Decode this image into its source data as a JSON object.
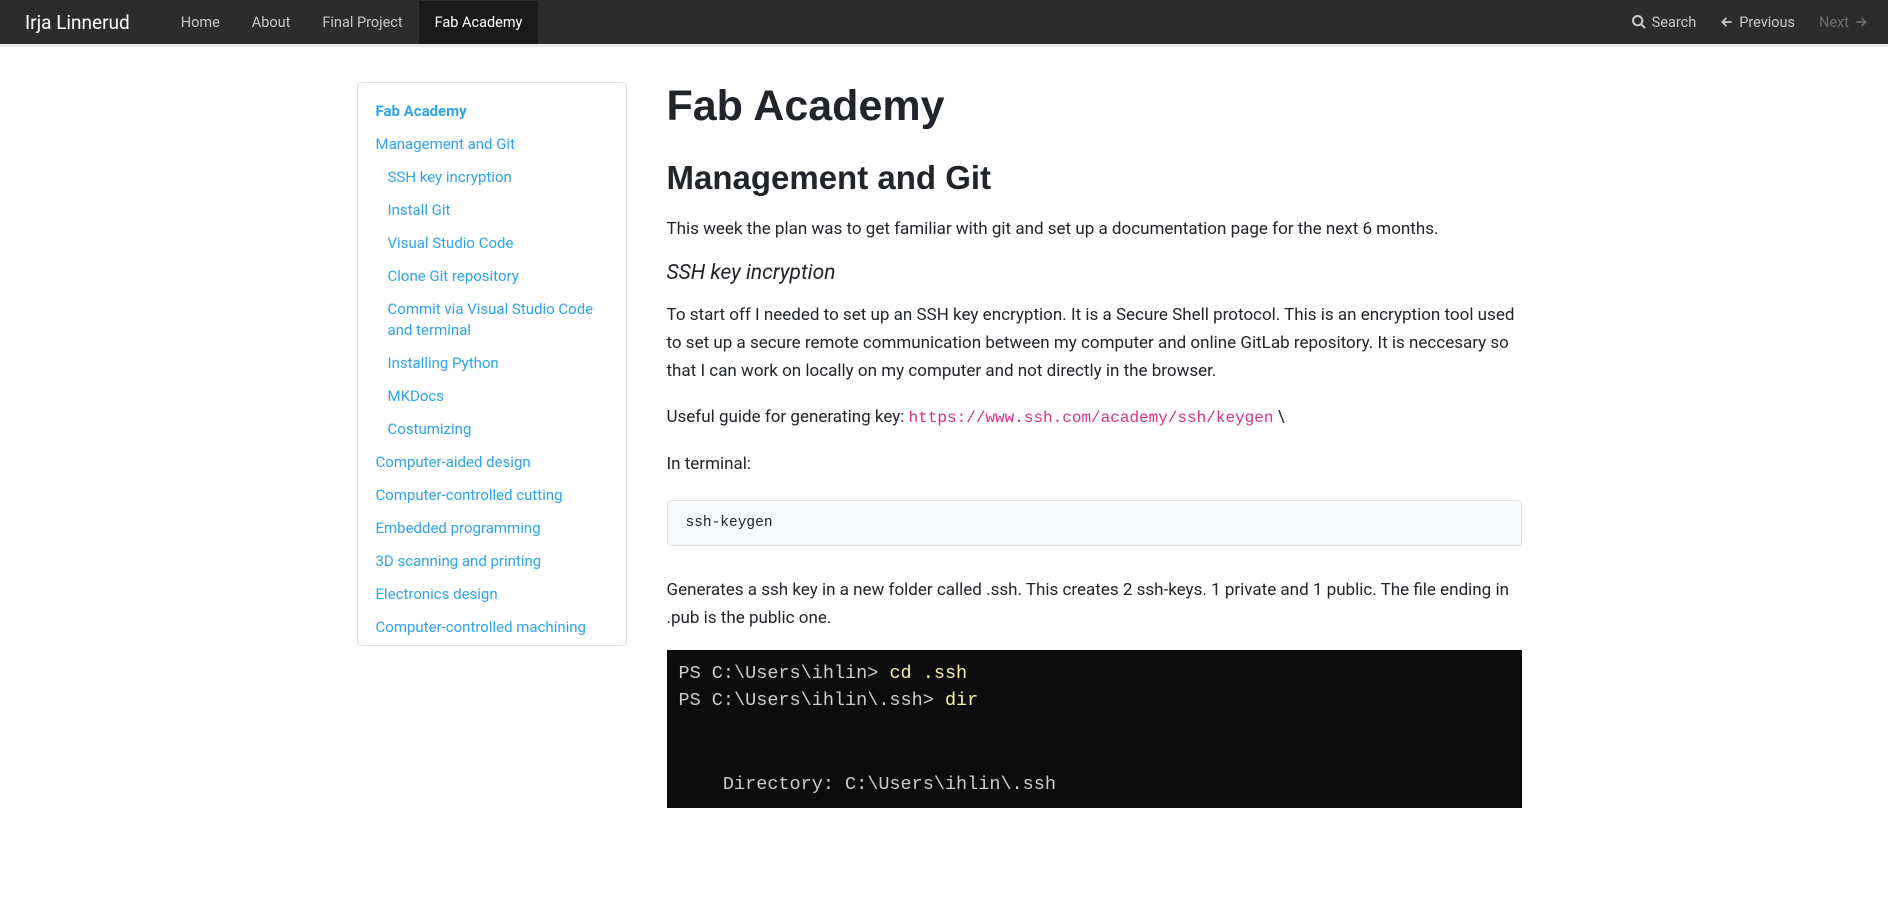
{
  "navbar": {
    "brand": "Irja Linnerud",
    "links": [
      {
        "label": "Home",
        "active": false
      },
      {
        "label": "About",
        "active": false
      },
      {
        "label": "Final Project",
        "active": false
      },
      {
        "label": "Fab Academy",
        "active": true
      }
    ],
    "search": "Search",
    "previous": "Previous",
    "next": "Next"
  },
  "sidebar": {
    "items": [
      {
        "label": "Fab Academy",
        "level": "main"
      },
      {
        "label": "Management and Git",
        "level": "top"
      },
      {
        "label": "SSH key incryption",
        "level": "sub"
      },
      {
        "label": "Install Git",
        "level": "sub"
      },
      {
        "label": "Visual Studio Code",
        "level": "sub"
      },
      {
        "label": "Clone Git repository",
        "level": "sub"
      },
      {
        "label": "Commit via Visual Studio Code and terminal",
        "level": "sub"
      },
      {
        "label": "Installing Python",
        "level": "sub"
      },
      {
        "label": "MKDocs",
        "level": "sub"
      },
      {
        "label": "Costumizing",
        "level": "sub"
      },
      {
        "label": "Computer-aided design",
        "level": "top"
      },
      {
        "label": "Computer-controlled cutting",
        "level": "top"
      },
      {
        "label": "Embedded programming",
        "level": "top"
      },
      {
        "label": "3D scanning and printing",
        "level": "top"
      },
      {
        "label": "Electronics design",
        "level": "top"
      },
      {
        "label": "Computer-controlled machining",
        "level": "top"
      }
    ]
  },
  "content": {
    "h1": "Fab Academy",
    "h2": "Management and Git",
    "p1": "This week the plan was to get familiar with git and set up a documentation page for the next 6 months.",
    "h3": "SSH key incryption",
    "p2": "To start off I needed to set up an SSH key encryption. It is a Secure Shell protocol. This is an encryption tool used to set up a secure remote communication between my computer and online GitLab repository. It is neccesary so that I can work on locally on my computer and not directly in the browser.",
    "p3_prefix": "Useful guide for generating key: ",
    "p3_link": "https://www.ssh.com/academy/ssh/keygen",
    "p3_suffix": " \\",
    "p4": "In terminal:",
    "code1": "ssh-keygen",
    "p5": "Generates a ssh key in a new folder called .ssh. This creates 2 ssh-keys. 1 private and 1 public. The file ending in .pub is the public one.",
    "terminal": {
      "line1_prompt": "PS C:\\Users\\ihlin> ",
      "line1_cmd": "cd .ssh",
      "line2_prompt": "PS C:\\Users\\ihlin\\.ssh> ",
      "line2_cmd": "dir",
      "line3": "    Directory: C:\\Users\\ihlin\\.ssh"
    }
  }
}
